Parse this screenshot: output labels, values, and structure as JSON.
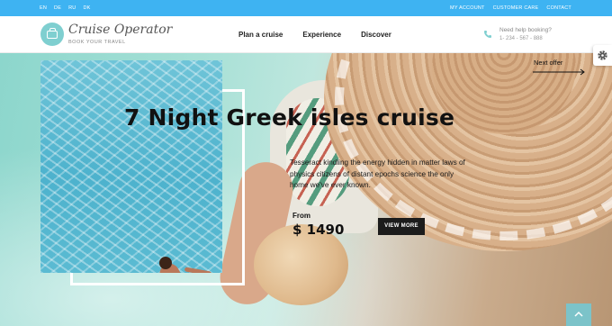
{
  "topbar": {
    "languages": [
      "EN",
      "DE",
      "RU",
      "DK"
    ],
    "links": [
      "MY ACCOUNT",
      "CUSTOMER CARE",
      "CONTACT"
    ]
  },
  "header": {
    "logo_name": "Cruise Operator",
    "logo_tagline": "BOOK YOUR TRAVEL",
    "logo_icon": "suitcase-icon",
    "nav": [
      "Plan a cruise",
      "Experience",
      "Discover"
    ],
    "help_label": "Need help booking?",
    "help_number": "1- 234 - 567 - 888",
    "phone_icon": "phone-icon"
  },
  "hero": {
    "title": "7 Night Greek isles cruise",
    "description": "Tesseract kindling the energy hidden in matter laws of physics citizens of distant epochs science the only home we've ever known.",
    "from_label": "From",
    "price": "$ 1490",
    "cta_label": "VIEW MORE",
    "next_offer_label": "Next offer"
  },
  "widgets": {
    "settings_icon": "gear-icon",
    "scroll_top_icon": "chevron-up-icon"
  },
  "colors": {
    "topbar": "#3eb3f2",
    "logo_accent": "#7fcfd0",
    "cta_background": "#1c1c1c",
    "scroll_top": "#7cc3c9"
  }
}
